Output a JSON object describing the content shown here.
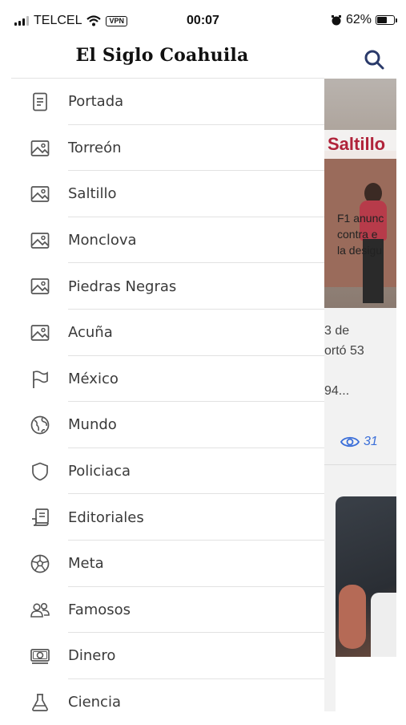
{
  "status_bar": {
    "carrier": "TELCEL",
    "vpn": "VPN",
    "time": "00:07",
    "battery": "62%",
    "battery_level": 0.62
  },
  "drawer": {
    "logo": "El Siglo Coahuila",
    "items": [
      {
        "label": "Portada",
        "icon": "document-icon"
      },
      {
        "label": "Torreón",
        "icon": "image-icon"
      },
      {
        "label": "Saltillo",
        "icon": "image-icon"
      },
      {
        "label": "Monclova",
        "icon": "image-icon"
      },
      {
        "label": "Piedras Negras",
        "icon": "image-icon"
      },
      {
        "label": "Acuña",
        "icon": "image-icon"
      },
      {
        "label": "México",
        "icon": "flag-icon"
      },
      {
        "label": "Mundo",
        "icon": "globe-icon"
      },
      {
        "label": "Policiaca",
        "icon": "shield-icon"
      },
      {
        "label": "Editoriales",
        "icon": "editorial-icon"
      },
      {
        "label": "Meta",
        "icon": "soccer-ball-icon"
      },
      {
        "label": "Famosos",
        "icon": "people-icon"
      },
      {
        "label": "Dinero",
        "icon": "money-icon"
      },
      {
        "label": "Ciencia",
        "icon": "flask-icon"
      }
    ]
  },
  "background": {
    "section_tag": "Saltillo",
    "excerpt_lines": [
      "3 de",
      "ortó 53",
      "",
      "94..."
    ],
    "views": "31",
    "card_text_lines": [
      "F1 anunc",
      "contra e",
      "la desigu"
    ],
    "accent_color": "#b0233a",
    "link_color": "#3b6fd9"
  }
}
